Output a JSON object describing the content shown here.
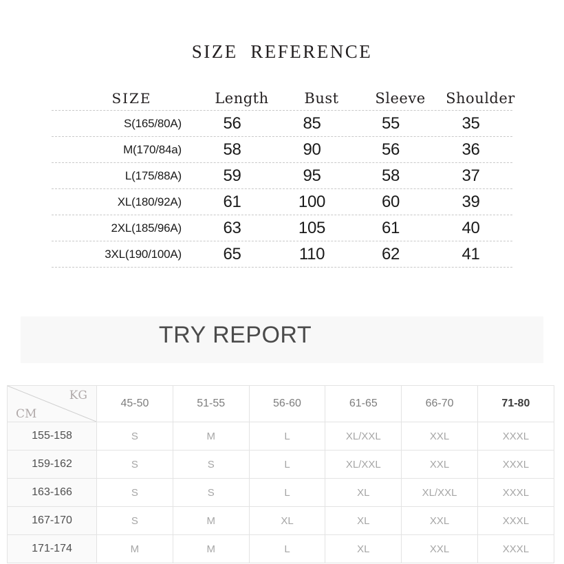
{
  "size_reference": {
    "title": "SIZE  REFERENCE",
    "columns": [
      "SIZE",
      "Length",
      "Bust",
      "Sleeve",
      "Shoulder"
    ],
    "rows": [
      {
        "size": "S(165/80A)",
        "length": "56",
        "bust": "85",
        "sleeve": "55",
        "shoulder": "35"
      },
      {
        "size": "M(170/84a)",
        "length": "58",
        "bust": "90",
        "sleeve": "56",
        "shoulder": "36"
      },
      {
        "size": "L(175/88A)",
        "length": "59",
        "bust": "95",
        "sleeve": "58",
        "shoulder": "37"
      },
      {
        "size": "XL(180/92A)",
        "length": "61",
        "bust": "100",
        "sleeve": "60",
        "shoulder": "39"
      },
      {
        "size": "2XL(185/96A)",
        "length": "63",
        "bust": "105",
        "sleeve": "61",
        "shoulder": "40"
      },
      {
        "size": "3XL(190/100A)",
        "length": "65",
        "bust": "110",
        "sleeve": "62",
        "shoulder": "41"
      }
    ]
  },
  "try_report": {
    "title": "TRY REPORT"
  },
  "fit_table": {
    "corner": {
      "weight_axis_label": "KG",
      "height_axis_label": "CM"
    },
    "weight_columns": [
      "45-50",
      "51-55",
      "56-60",
      "61-65",
      "66-70",
      "71-80"
    ],
    "emphasized_weight_column": "71-80",
    "rows": [
      {
        "height": "155-158",
        "sizes": [
          "S",
          "M",
          "L",
          "XL/XXL",
          "XXL",
          "XXXL"
        ]
      },
      {
        "height": "159-162",
        "sizes": [
          "S",
          "S",
          "L",
          "XL/XXL",
          "XXL",
          "XXXL"
        ]
      },
      {
        "height": "163-166",
        "sizes": [
          "S",
          "S",
          "L",
          "XL",
          "XL/XXL",
          "XXXL"
        ]
      },
      {
        "height": "167-170",
        "sizes": [
          "S",
          "M",
          "XL",
          "XL",
          "XXL",
          "XXXL"
        ]
      },
      {
        "height": "171-174",
        "sizes": [
          "M",
          "M",
          "L",
          "XL",
          "XXL",
          "XXXL"
        ]
      }
    ]
  },
  "colors": {
    "text_dark": "#231f20",
    "text_gray": "#9a9a9a",
    "band_background": "#f8f8f8",
    "grid_line": "#e3e3e3",
    "dashed_line": "#c8c8c8"
  }
}
